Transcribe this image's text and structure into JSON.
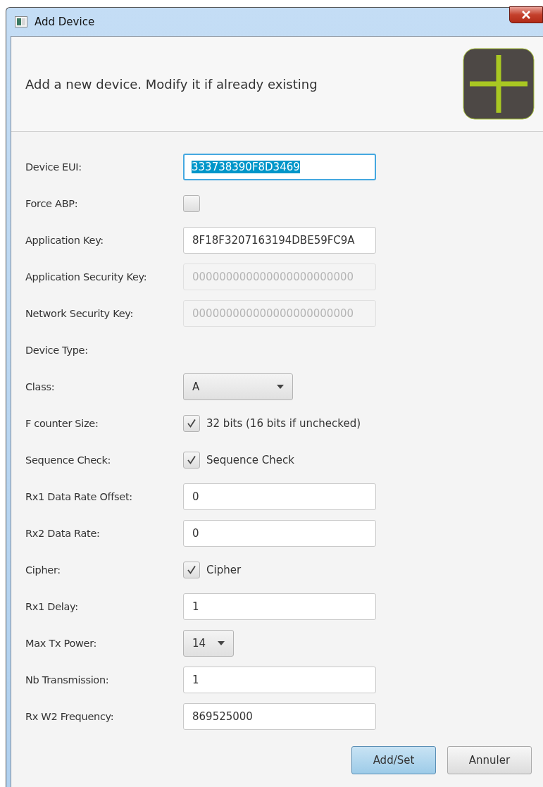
{
  "window": {
    "title": "Add Device"
  },
  "header": {
    "message": "Add a new device. Modify it if already existing"
  },
  "fields": [
    {
      "kind": "text",
      "label": "Device EUI:",
      "value": "333738390F8D3469",
      "focused": true,
      "selected_text": true,
      "disabled": false
    },
    {
      "kind": "checkbox",
      "label": "Force ABP:",
      "checked": false
    },
    {
      "kind": "text",
      "label": "Application Key:",
      "value": "8F18F3207163194DBE59FC9A",
      "focused": false,
      "selected_text": false,
      "disabled": false
    },
    {
      "kind": "text",
      "label": "Application Security Key:",
      "value": "000000000000000000000000",
      "focused": false,
      "selected_text": false,
      "disabled": true
    },
    {
      "kind": "text",
      "label": "Network Security Key:",
      "value": "000000000000000000000000",
      "focused": false,
      "selected_text": false,
      "disabled": true
    },
    {
      "kind": "heading",
      "label": "Device Type:"
    },
    {
      "kind": "select",
      "label": "Class:",
      "value": "A"
    },
    {
      "kind": "checkbox",
      "label": "F counter Size:",
      "checked": true,
      "text": "32 bits (16 bits if unchecked)"
    },
    {
      "kind": "checkbox",
      "label": "Sequence Check:",
      "checked": true,
      "text": "Sequence Check"
    },
    {
      "kind": "text",
      "label": "Rx1 Data Rate Offset:",
      "value": "0",
      "focused": false,
      "selected_text": false,
      "disabled": false
    },
    {
      "kind": "text",
      "label": "Rx2 Data Rate:",
      "value": "0",
      "focused": false,
      "selected_text": false,
      "disabled": false
    },
    {
      "kind": "checkbox",
      "label": "Cipher:",
      "checked": true,
      "text": "Cipher"
    },
    {
      "kind": "text",
      "label": "Rx1 Delay:",
      "value": "1",
      "focused": false,
      "selected_text": false,
      "disabled": false
    },
    {
      "kind": "compact-select",
      "label": "Max Tx Power:",
      "value": "14"
    },
    {
      "kind": "text",
      "label": "Nb Transmission:",
      "value": "1",
      "focused": false,
      "selected_text": false,
      "disabled": false
    },
    {
      "kind": "text",
      "label": "Rx W2 Frequency:",
      "value": "869525000",
      "focused": false,
      "selected_text": false,
      "disabled": false
    }
  ],
  "buttons": [
    {
      "label": "Add/Set",
      "default": true
    },
    {
      "label": "Annuler",
      "default": false
    }
  ]
}
